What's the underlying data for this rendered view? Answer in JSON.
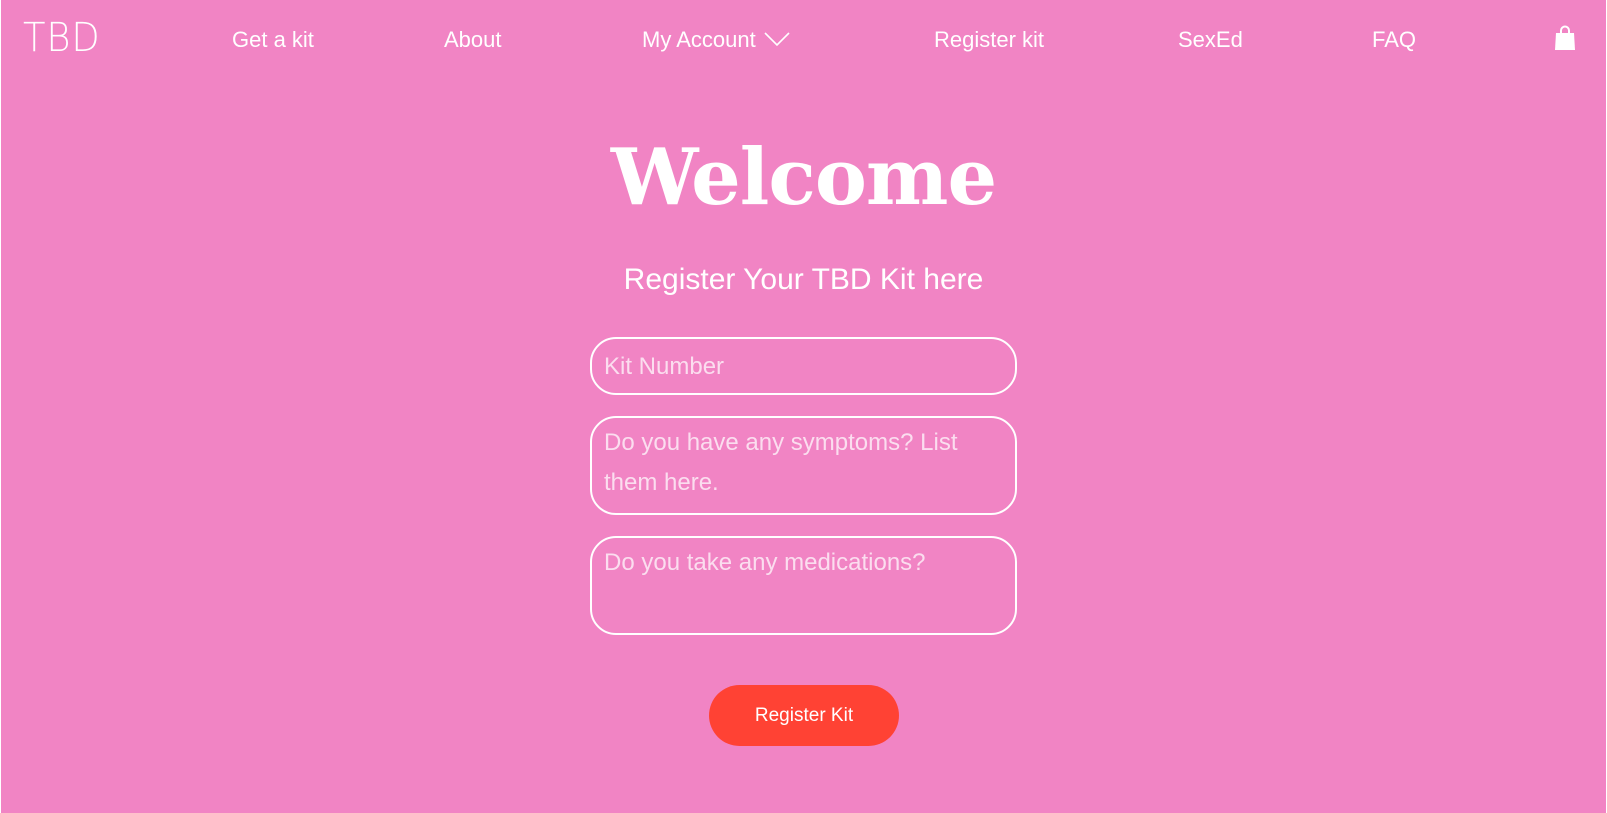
{
  "header": {
    "logo": "TBD",
    "nav": {
      "get_kit": "Get a kit",
      "about": "About",
      "my_account": "My Account",
      "register_kit": "Register kit",
      "sexed": "SexEd",
      "faq": "FAQ"
    },
    "cart_icon": "shopping-bag-icon",
    "account_chevron_icon": "chevron-down-icon"
  },
  "main": {
    "title": "Welcome",
    "subtitle": "Register Your TBD Kit here",
    "fields": {
      "kit_number": {
        "value": "",
        "placeholder": "Kit Number"
      },
      "symptoms": {
        "value": "",
        "placeholder": "Do you have any symptoms? List them here."
      },
      "medications": {
        "value": "",
        "placeholder": "Do you take any medications?"
      }
    },
    "submit_label": "Register Kit"
  },
  "colors": {
    "background": "#f184c4",
    "accent_button": "#ff4234",
    "text": "#ffffff"
  }
}
